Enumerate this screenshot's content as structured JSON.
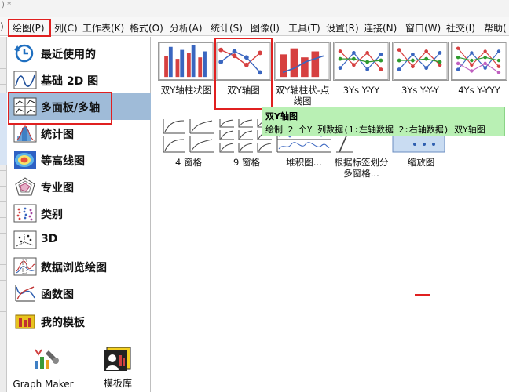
{
  "title_bar": {
    "fragment": ") *"
  },
  "menu": {
    "edge_char": ")",
    "items": [
      {
        "label": "绘图(P)"
      },
      {
        "label": "列(C)"
      },
      {
        "label": "工作表(K)"
      },
      {
        "label": "格式(O)"
      },
      {
        "label": "分析(A)"
      },
      {
        "label": "统计(S)"
      },
      {
        "label": "图像(I)"
      },
      {
        "label": "工具(T)"
      },
      {
        "label": "设置(R)"
      },
      {
        "label": "连接(N)"
      },
      {
        "label": "窗口(W)"
      },
      {
        "label": "社交(I)"
      },
      {
        "label": "帮助("
      }
    ]
  },
  "categories": [
    {
      "label": "最近使用的",
      "icon": "clock-icon"
    },
    {
      "label": "基础 2D 图",
      "icon": "line-2d-icon"
    },
    {
      "label": "多面板/多轴",
      "icon": "multi-panel-icon",
      "selected": true
    },
    {
      "label": "统计图",
      "icon": "histogram-icon"
    },
    {
      "label": "等高线图",
      "icon": "contour-icon"
    },
    {
      "label": "专业图",
      "icon": "radar-icon"
    },
    {
      "label": "类别",
      "icon": "scatter-category-icon"
    },
    {
      "label": "3D",
      "icon": "3d-scatter-icon"
    },
    {
      "label": "数据浏览绘图",
      "icon": "data-explore-icon"
    },
    {
      "label": "函数图",
      "icon": "function-plot-icon"
    },
    {
      "label": "我的模板",
      "icon": "my-template-icon"
    }
  ],
  "bottom_tools": [
    {
      "label": "Graph Maker",
      "icon": "graph-maker-icon"
    },
    {
      "label": "模板库",
      "icon": "template-library-icon"
    }
  ],
  "templates_row1": [
    {
      "label": "双Y轴柱状图",
      "icon": "double-y-bar-icon"
    },
    {
      "label": "双Y轴图",
      "icon": "double-y-line-icon",
      "highlighted": true
    },
    {
      "label": "双Y轴柱状-点线图",
      "icon": "double-y-bar-line-icon"
    },
    {
      "label": "3Ys Y-YY",
      "icon": "3ys-y-yy-icon"
    },
    {
      "label": "3Ys Y-Y-Y",
      "icon": "3ys-y-y-y-icon"
    },
    {
      "label": "4Ys Y-YYY",
      "icon": "4ys-y-yyy-icon"
    }
  ],
  "templates_row2": [
    {
      "label": "4 窗格",
      "icon": "4-panel-icon"
    },
    {
      "label": "9 窗格",
      "icon": "9-panel-icon"
    },
    {
      "label": "堆积图...",
      "icon": "stack-icon"
    },
    {
      "label": "根据标签划分多窗格...",
      "icon": "label-panel-icon"
    },
    {
      "label": "缩放图",
      "icon": "zoom-icon"
    }
  ],
  "tooltip": {
    "title": "双Y轴图",
    "text": "绘制 2 个Y 列数据(1:左轴数据 2:右轴数据) 双Y轴图"
  },
  "colors": {
    "highlight": "#e02020",
    "selected_bg": "#9fbbd8",
    "tooltip_bg": "#b9f0b4"
  }
}
